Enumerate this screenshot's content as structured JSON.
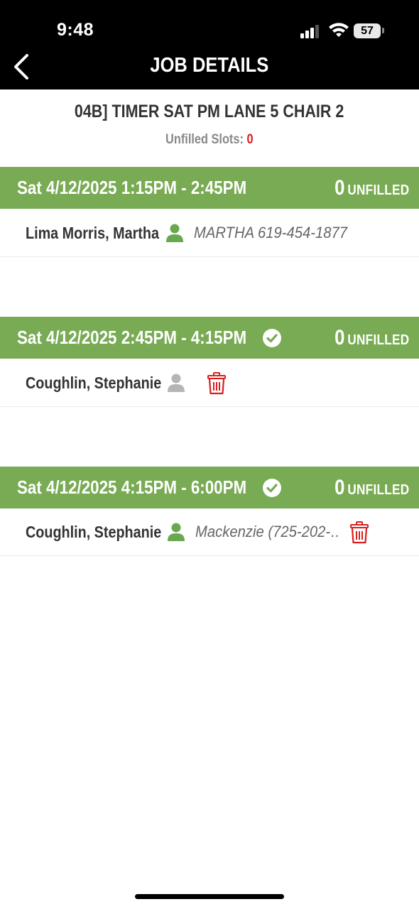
{
  "status_bar": {
    "time": "9:48",
    "battery": "57"
  },
  "nav": {
    "title": "JOB DETAILS",
    "back_icon": "chevron-left-icon"
  },
  "job": {
    "title": "04B] TIMER SAT PM LANE 5 CHAIR 2",
    "unfilled_label": "Unfilled Slots:",
    "unfilled_count": "0"
  },
  "colors": {
    "header_green": "#78ab53",
    "accent_red": "#d81f1f",
    "person_green": "#6aa84f",
    "person_gray": "#b5b5b5"
  },
  "slots": [
    {
      "time": "Sat 4/12/2025 1:15PM - 2:45PM",
      "checked": false,
      "unfilled_count": "0",
      "unfilled_label": "UNFILLED",
      "assignee": {
        "name": "Lima Morris, Martha",
        "icon_state": "green",
        "note": "MARTHA 619-454-1877",
        "has_delete": false
      }
    },
    {
      "time": "Sat 4/12/2025 2:45PM - 4:15PM",
      "checked": true,
      "unfilled_count": "0",
      "unfilled_label": "UNFILLED",
      "assignee": {
        "name": "Coughlin, Stephanie",
        "icon_state": "gray",
        "note": "",
        "has_delete": true
      }
    },
    {
      "time": "Sat 4/12/2025 4:15PM - 6:00PM",
      "checked": true,
      "unfilled_count": "0",
      "unfilled_label": "UNFILLED",
      "assignee": {
        "name": "Coughlin, Stephanie",
        "icon_state": "green",
        "note": "Mackenzie (725-202-…",
        "has_delete": true
      }
    }
  ]
}
